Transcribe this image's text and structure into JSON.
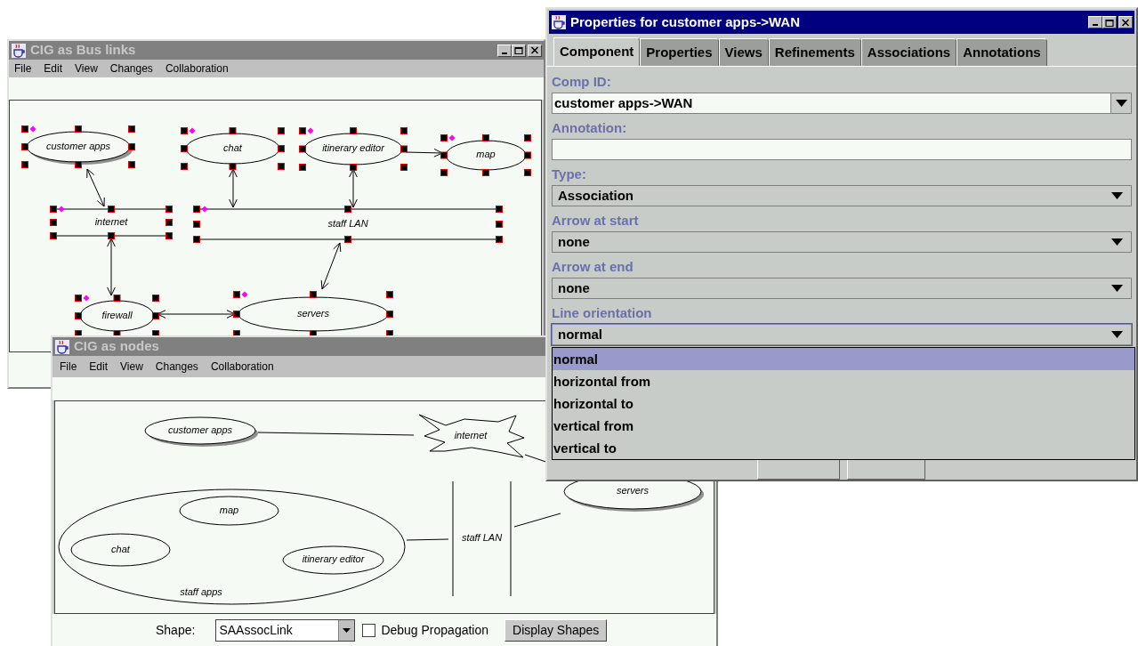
{
  "windows": [
    {
      "kind": "editor",
      "title": "CIG as Bus links",
      "active": false,
      "menu": [
        "File",
        "Edit",
        "View",
        "Changes",
        "Collaboration"
      ],
      "nodes": [
        {
          "label": "customer apps",
          "kind": "ellipse",
          "shadow": true,
          "selected": true
        },
        {
          "label": "chat",
          "kind": "ellipse",
          "shadow": false,
          "selected": true
        },
        {
          "label": "itinerary editor",
          "kind": "ellipse",
          "shadow": false,
          "selected": true
        },
        {
          "label": "map",
          "kind": "ellipse",
          "shadow": false,
          "selected": true
        },
        {
          "label": "internet",
          "kind": "bus",
          "selected": true
        },
        {
          "label": "staff LAN",
          "kind": "bus",
          "selected": true
        },
        {
          "label": "firewall",
          "kind": "ellipse",
          "shadow": false,
          "selected": true
        },
        {
          "label": "servers",
          "kind": "ellipse",
          "shadow": false,
          "selected": true
        }
      ]
    },
    {
      "kind": "editor",
      "title": "CIG as nodes",
      "active": false,
      "menu": [
        "File",
        "Edit",
        "View",
        "Changes",
        "Collaboration"
      ],
      "nodes": [
        {
          "label": "customer apps",
          "kind": "ellipse",
          "shadow": true,
          "selected": false
        },
        {
          "label": "internet",
          "kind": "cloud",
          "selected": false
        },
        {
          "label": "staff apps",
          "kind": "group",
          "selected": false,
          "children": [
            {
              "label": "map",
              "kind": "ellipse",
              "shadow": false,
              "selected": false
            },
            {
              "label": "chat",
              "kind": "ellipse",
              "shadow": false,
              "selected": false
            },
            {
              "label": "itinerary editor",
              "kind": "ellipse",
              "shadow": false,
              "selected": false
            }
          ]
        },
        {
          "label": "staff LAN",
          "kind": "bus",
          "selected": false
        },
        {
          "label": "servers",
          "kind": "ellipse",
          "shadow": true,
          "selected": false
        }
      ],
      "footer": {
        "shape_label": "Shape:",
        "shape_value": "SAAssocLink",
        "debug": {
          "label": "Debug Propagation",
          "checked": false
        },
        "button": "Display Shapes"
      }
    },
    {
      "kind": "dialog",
      "title": "Properties for customer apps->WAN",
      "active": true,
      "tabs": [
        {
          "label": "Component",
          "selected": true
        },
        {
          "label": "Properties",
          "selected": false
        },
        {
          "label": "Views",
          "selected": false
        },
        {
          "label": "Refinements",
          "selected": false
        },
        {
          "label": "Associations",
          "selected": false
        },
        {
          "label": "Annotations",
          "selected": false
        }
      ],
      "fields": [
        {
          "label": "Comp ID:",
          "kind": "editable-combo",
          "value": "customer apps->WAN"
        },
        {
          "label": "Annotation:",
          "kind": "text"
        },
        {
          "label": "Type:",
          "kind": "combo",
          "value": "Association"
        },
        {
          "label": "Arrow at start",
          "kind": "combo",
          "value": "none"
        },
        {
          "label": "Arrow at end",
          "kind": "combo",
          "value": "none"
        },
        {
          "label": "Line orientation",
          "kind": "combo",
          "value": "normal",
          "open": true,
          "options": [
            {
              "label": "normal",
              "selected": true
            },
            {
              "label": "horizontal from",
              "selected": false
            },
            {
              "label": "horizontal to",
              "selected": false
            },
            {
              "label": "vertical from",
              "selected": false
            },
            {
              "label": "vertical to",
              "selected": false
            }
          ]
        }
      ],
      "buttons": [
        {
          "kind": "push"
        },
        {
          "kind": "push"
        }
      ]
    }
  ]
}
